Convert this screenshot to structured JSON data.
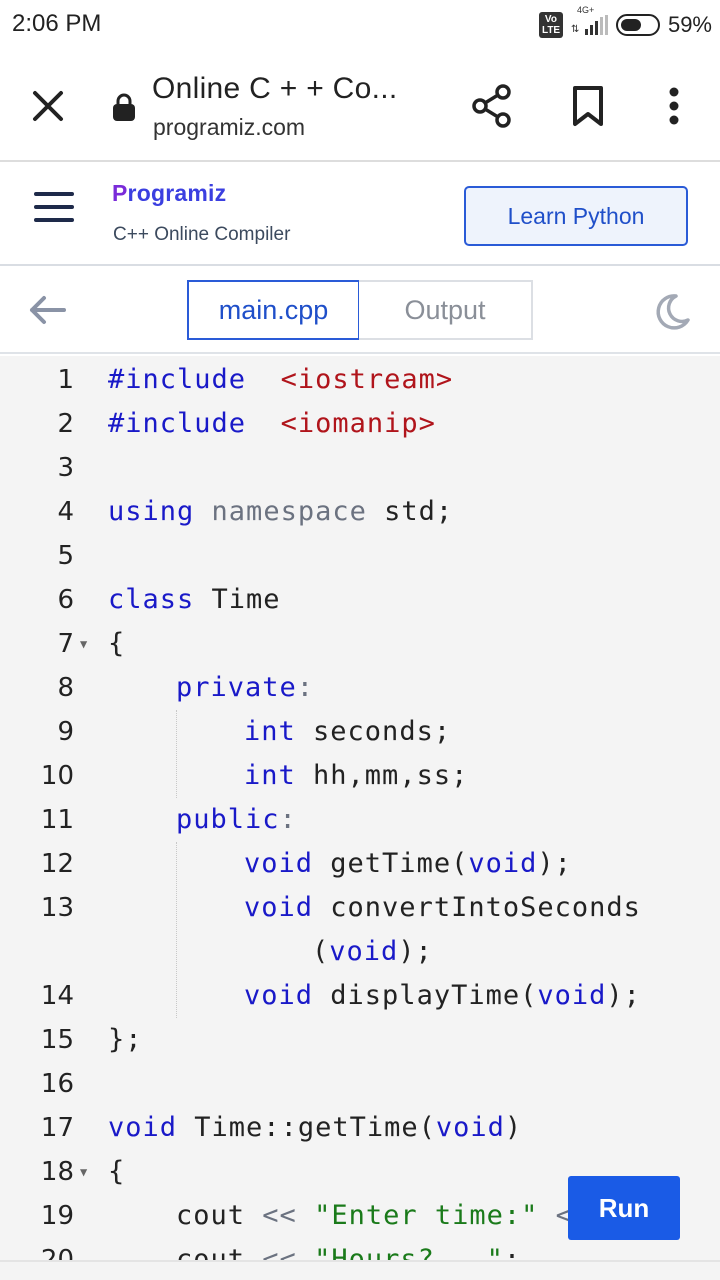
{
  "status_bar": {
    "time": "2:06 PM",
    "volte": "Vo LTE",
    "network": "4G+",
    "battery_percent_text": "59%",
    "battery_level": 0.59
  },
  "browser": {
    "tab_title": "Online C + + Co...",
    "host": "programiz.com",
    "icons": [
      "close-icon",
      "lock-icon",
      "share-icon",
      "bookmark-icon",
      "more-vert-icon"
    ]
  },
  "site": {
    "logo": "Programiz",
    "logo_first": "P",
    "logo_rest": "rogramiz",
    "subtitle": "C++ Online Compiler",
    "cta_label": "Learn Python",
    "accent": "#2a5bd7"
  },
  "tabs": {
    "active": "main.cpp",
    "inactive": "Output"
  },
  "editor": {
    "lines": [
      {
        "n": "1",
        "fold": false,
        "indent": 0,
        "tokens": [
          [
            "kw",
            "#include"
          ],
          [
            "",
            "  "
          ],
          [
            "inc",
            "<iostream>"
          ]
        ]
      },
      {
        "n": "2",
        "fold": false,
        "indent": 0,
        "tokens": [
          [
            "kw",
            "#include"
          ],
          [
            "",
            "  "
          ],
          [
            "inc",
            "<iomanip>"
          ]
        ]
      },
      {
        "n": "3",
        "fold": false,
        "indent": 0,
        "tokens": []
      },
      {
        "n": "4",
        "fold": false,
        "indent": 0,
        "tokens": [
          [
            "kw",
            "using"
          ],
          [
            "",
            " "
          ],
          [
            "ns",
            "namespace"
          ],
          [
            "",
            " std;"
          ]
        ]
      },
      {
        "n": "5",
        "fold": false,
        "indent": 0,
        "tokens": []
      },
      {
        "n": "6",
        "fold": false,
        "indent": 0,
        "tokens": [
          [
            "kw",
            "class"
          ],
          [
            "",
            " Time"
          ]
        ]
      },
      {
        "n": "7",
        "fold": true,
        "indent": 0,
        "tokens": [
          [
            "",
            "{"
          ]
        ]
      },
      {
        "n": "8",
        "fold": false,
        "indent": 1,
        "tokens": [
          [
            "kw",
            "private"
          ],
          [
            "op",
            ":"
          ]
        ]
      },
      {
        "n": "9",
        "fold": false,
        "indent": 2,
        "tokens": [
          [
            "kw",
            "int"
          ],
          [
            "",
            " seconds;"
          ]
        ]
      },
      {
        "n": "10",
        "fold": false,
        "indent": 2,
        "tokens": [
          [
            "kw",
            "int"
          ],
          [
            "",
            " hh,mm,ss;"
          ]
        ]
      },
      {
        "n": "11",
        "fold": false,
        "indent": 1,
        "tokens": [
          [
            "kw",
            "public"
          ],
          [
            "op",
            ":"
          ]
        ]
      },
      {
        "n": "12",
        "fold": false,
        "indent": 2,
        "tokens": [
          [
            "kw",
            "void"
          ],
          [
            "",
            " getTime("
          ],
          [
            "kw",
            "void"
          ],
          [
            "",
            ");"
          ]
        ]
      },
      {
        "n": "13",
        "fold": false,
        "indent": 2,
        "tokens": [
          [
            "kw",
            "void"
          ],
          [
            "",
            " convertIntoSeconds"
          ]
        ]
      },
      {
        "n": "",
        "fold": false,
        "indent": 3,
        "tokens": [
          [
            "",
            "("
          ],
          [
            "kw",
            "void"
          ],
          [
            "",
            ");"
          ]
        ]
      },
      {
        "n": "14",
        "fold": false,
        "indent": 2,
        "tokens": [
          [
            "kw",
            "void"
          ],
          [
            "",
            " displayTime("
          ],
          [
            "kw",
            "void"
          ],
          [
            "",
            ");"
          ]
        ]
      },
      {
        "n": "15",
        "fold": false,
        "indent": 0,
        "tokens": [
          [
            "",
            "};"
          ]
        ]
      },
      {
        "n": "16",
        "fold": false,
        "indent": 0,
        "tokens": []
      },
      {
        "n": "17",
        "fold": false,
        "indent": 0,
        "tokens": [
          [
            "kw",
            "void"
          ],
          [
            "",
            " Time::getTime("
          ],
          [
            "kw",
            "void"
          ],
          [
            "",
            ")"
          ]
        ]
      },
      {
        "n": "18",
        "fold": true,
        "indent": 0,
        "tokens": [
          [
            "",
            "{"
          ]
        ]
      },
      {
        "n": "19",
        "fold": false,
        "indent": 1,
        "tokens": [
          [
            "",
            "cout "
          ],
          [
            "op",
            "<<"
          ],
          [
            "",
            " "
          ],
          [
            "str",
            "\"Enter time:\""
          ],
          [
            "",
            " "
          ],
          [
            "op",
            "<"
          ]
        ]
      },
      {
        "n": "20",
        "fold": false,
        "indent": 1,
        "tokens": [
          [
            "",
            "cout "
          ],
          [
            "op",
            "<<"
          ],
          [
            "",
            " "
          ],
          [
            "str",
            "\"Hours?   \""
          ],
          [
            "",
            ";"
          ]
        ]
      }
    ],
    "run_label": "Run"
  }
}
